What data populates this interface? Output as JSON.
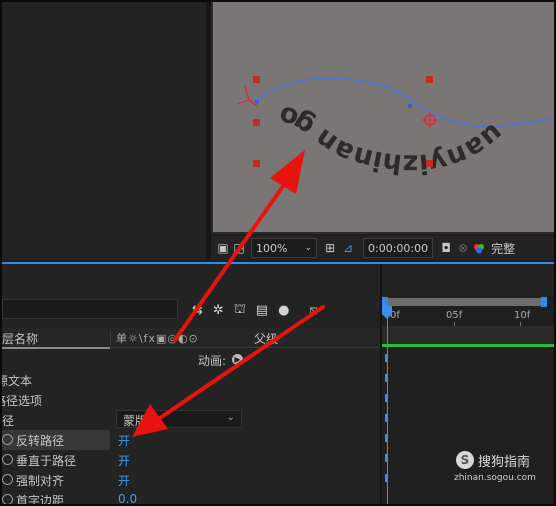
{
  "viewer": {
    "text_on_path": "uanyizhinan go",
    "zoom": "100%",
    "timecode": "0:00:00:00",
    "quality": "完整"
  },
  "timeline": {
    "search_placeholder": "",
    "columns": {
      "layer_name": "层名称",
      "switch_icons": "单☼\\fx▣◎◐⊙",
      "parent": "父级"
    },
    "animate_label": "动画:",
    "ruler": {
      "labels": [
        "0f",
        "05f",
        "10f"
      ]
    },
    "rows": [
      {
        "label": "源文本",
        "value": ""
      },
      {
        "label": "路径选项",
        "value": ""
      },
      {
        "label": "路径",
        "value": "蒙版"
      },
      {
        "label": "反转路径",
        "value": "开"
      },
      {
        "label": "垂直于路径",
        "value": "开"
      },
      {
        "label": "强制对齐",
        "value": "开"
      },
      {
        "label": "首字边距",
        "value": "0.0"
      }
    ]
  },
  "watermark": {
    "brand": "搜狗指南",
    "url": "zhinan.sogou.com"
  },
  "annotation_color": "#e8130c",
  "accent_color": "#2d8ceb"
}
